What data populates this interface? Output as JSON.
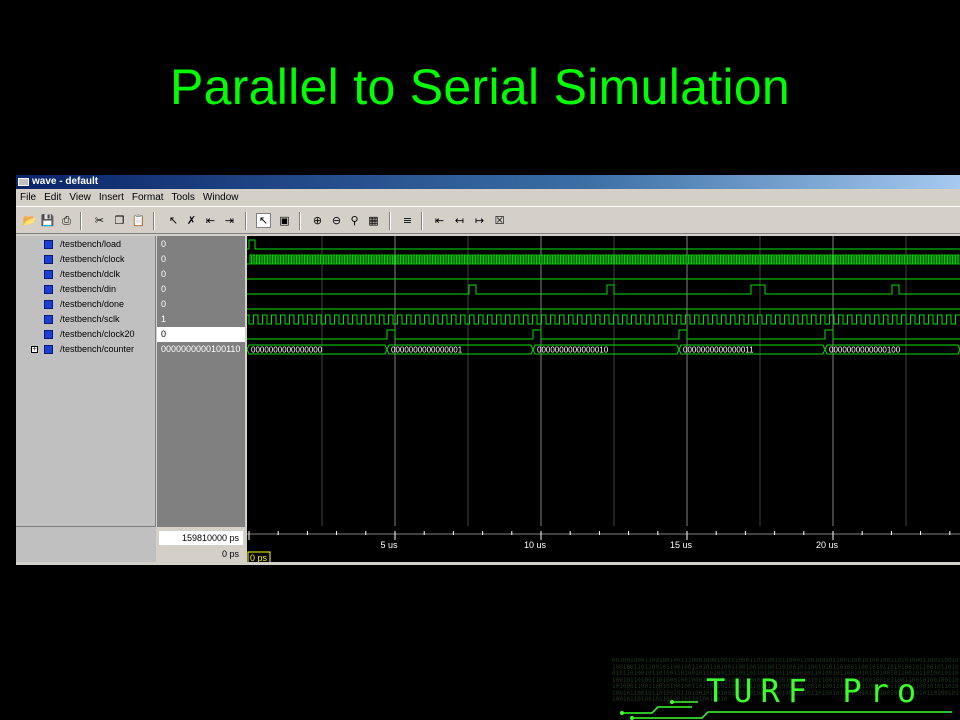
{
  "slide": {
    "title": "Parallel to Serial Simulation"
  },
  "window": {
    "title": "wave - default",
    "menu": [
      "File",
      "Edit",
      "View",
      "Insert",
      "Format",
      "Tools",
      "Window"
    ]
  },
  "toolbar": {
    "icons": [
      "open-file-icon",
      "save-icon",
      "print-icon",
      "cut-icon",
      "copy-icon",
      "paste-icon",
      "select-icon",
      "delete-icon",
      "insert-cursor-icon",
      "delete-cursor-icon",
      "pointer-icon",
      "zoom-area-icon",
      "zoom-in-icon",
      "zoom-out-icon",
      "zoom-full-icon",
      "zoom-fit-icon",
      "find-icon",
      "first-edge-icon",
      "prev-edge-icon",
      "next-edge-icon",
      "stop-icon"
    ]
  },
  "signals": [
    {
      "name": "/testbench/load",
      "value": "0"
    },
    {
      "name": "/testbench/clock",
      "value": "0"
    },
    {
      "name": "/testbench/dclk",
      "value": "0"
    },
    {
      "name": "/testbench/din",
      "value": "0"
    },
    {
      "name": "/testbench/done",
      "value": "0"
    },
    {
      "name": "/testbench/sclk",
      "value": "1"
    },
    {
      "name": "/testbench/clock20",
      "value": "0"
    },
    {
      "name": "/testbench/counter",
      "value": "0000000000100110"
    }
  ],
  "counter_values": [
    "0000000000000000",
    "0000000000000001",
    "0000000000000010",
    "0000000000000011",
    "0000000000000100"
  ],
  "cursor": {
    "time": "159810000 ps",
    "start": "0 ps",
    "marker": "0 ps"
  },
  "timeline": {
    "labels": [
      "5 us",
      "10 us",
      "15 us",
      "20 us"
    ]
  },
  "colors": {
    "title": "#00ff00",
    "wave": "#00e000",
    "grid": "#808080",
    "logo": "#3aff2a"
  },
  "logo": {
    "text": "TURF Pro",
    "bits": "0010010001100100100111000100010010100011011001011000110010010110011001010010011010100011001100101001001101100101100100110101101001100100101001101001011001010110100110010101101010010110010110100101101001011010011010010110100110100101101001011010010110100101100101011010010110010110100101101001011010011010"
  }
}
